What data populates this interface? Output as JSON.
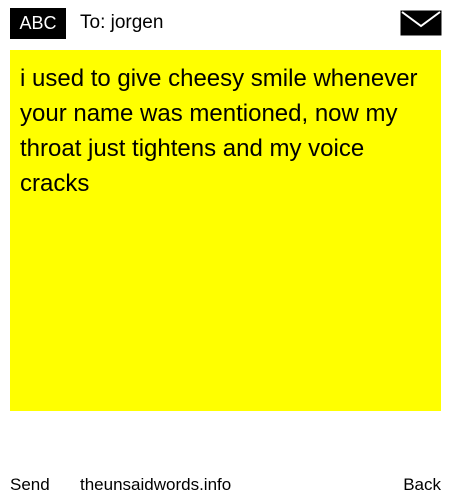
{
  "header": {
    "input_mode": "ABC",
    "recipient_label": "To: jorgen",
    "envelope_icon": "envelope-icon"
  },
  "message": {
    "text": "i used to give cheesy smile whenever your name was mentioned, now my throat just tightens and my voice cracks",
    "background_color": "#ffff00"
  },
  "footer": {
    "send_label": "Send",
    "site_label": "theunsaidwords.info",
    "back_label": "Back"
  }
}
